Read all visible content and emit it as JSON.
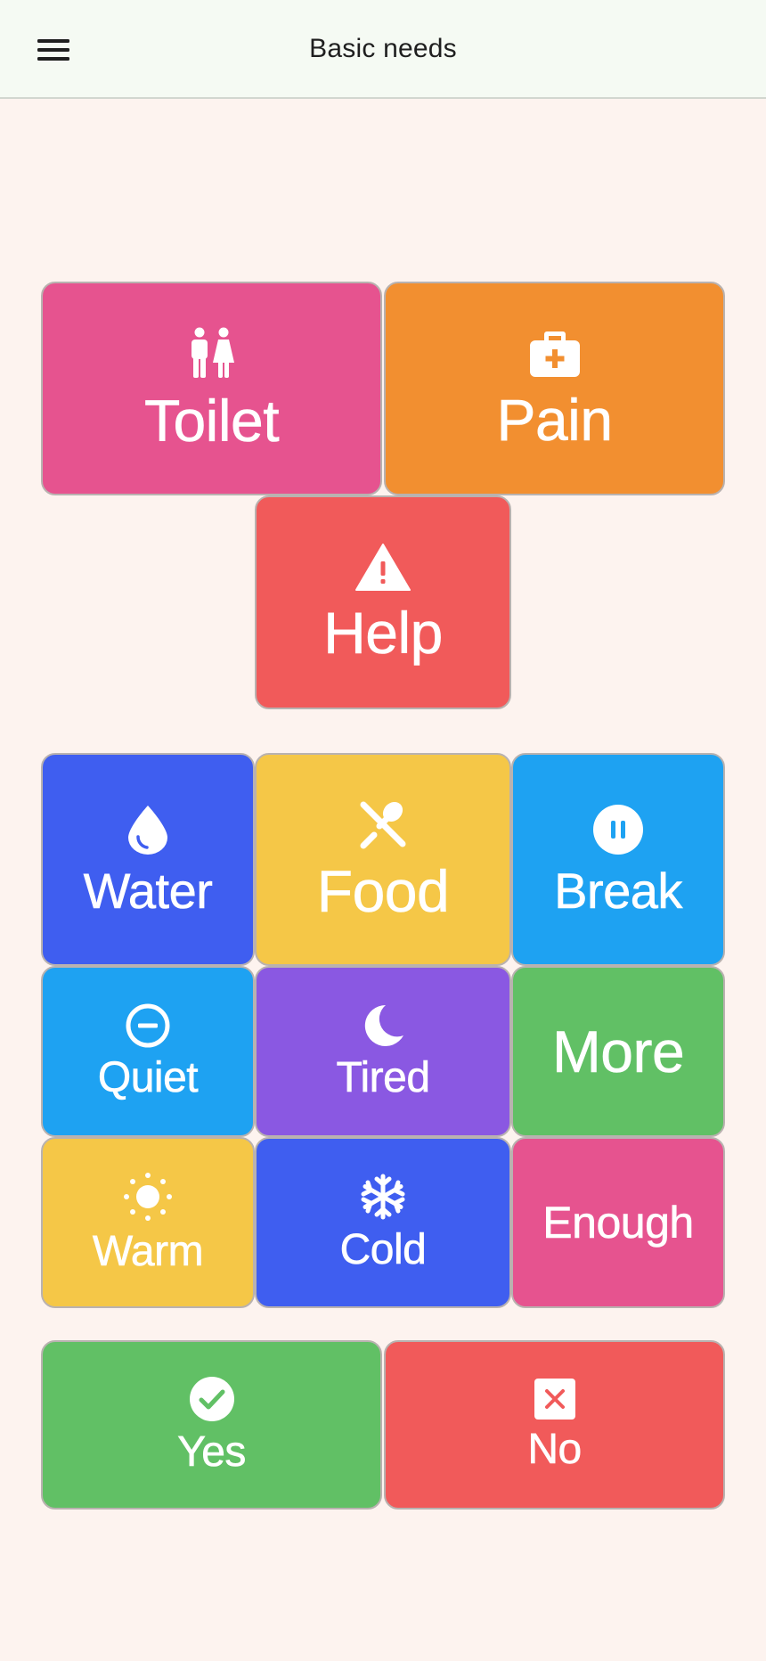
{
  "header": {
    "title": "Basic needs",
    "menu_icon": "hamburger-menu-icon"
  },
  "colors": {
    "pink": "#e6538f",
    "orange": "#f28f30",
    "red": "#f15a5a",
    "blue": "#3f5ef0",
    "yellow": "#f5c747",
    "skyblue": "#1ea2f2",
    "purple": "#8a58e2",
    "green": "#61c065",
    "background": "#fdf3ef",
    "appbar": "#f5faf3"
  },
  "tiles": {
    "toilet": {
      "label": "Toilet",
      "icon": "restroom-icon"
    },
    "pain": {
      "label": "Pain",
      "icon": "first-aid-kit-icon"
    },
    "help": {
      "label": "Help",
      "icon": "warning-triangle-icon"
    },
    "water": {
      "label": "Water",
      "icon": "water-drop-icon"
    },
    "food": {
      "label": "Food",
      "icon": "fork-spoon-icon"
    },
    "break": {
      "label": "Break",
      "icon": "pause-circle-icon"
    },
    "quiet": {
      "label": "Quiet",
      "icon": "do-not-disturb-icon"
    },
    "tired": {
      "label": "Tired",
      "icon": "moon-icon"
    },
    "more": {
      "label": "More"
    },
    "warm": {
      "label": "Warm",
      "icon": "sun-icon"
    },
    "cold": {
      "label": "Cold",
      "icon": "snowflake-icon"
    },
    "enough": {
      "label": "Enough"
    },
    "yes": {
      "label": "Yes",
      "icon": "check-circle-icon"
    },
    "no": {
      "label": "No",
      "icon": "close-box-icon"
    }
  }
}
